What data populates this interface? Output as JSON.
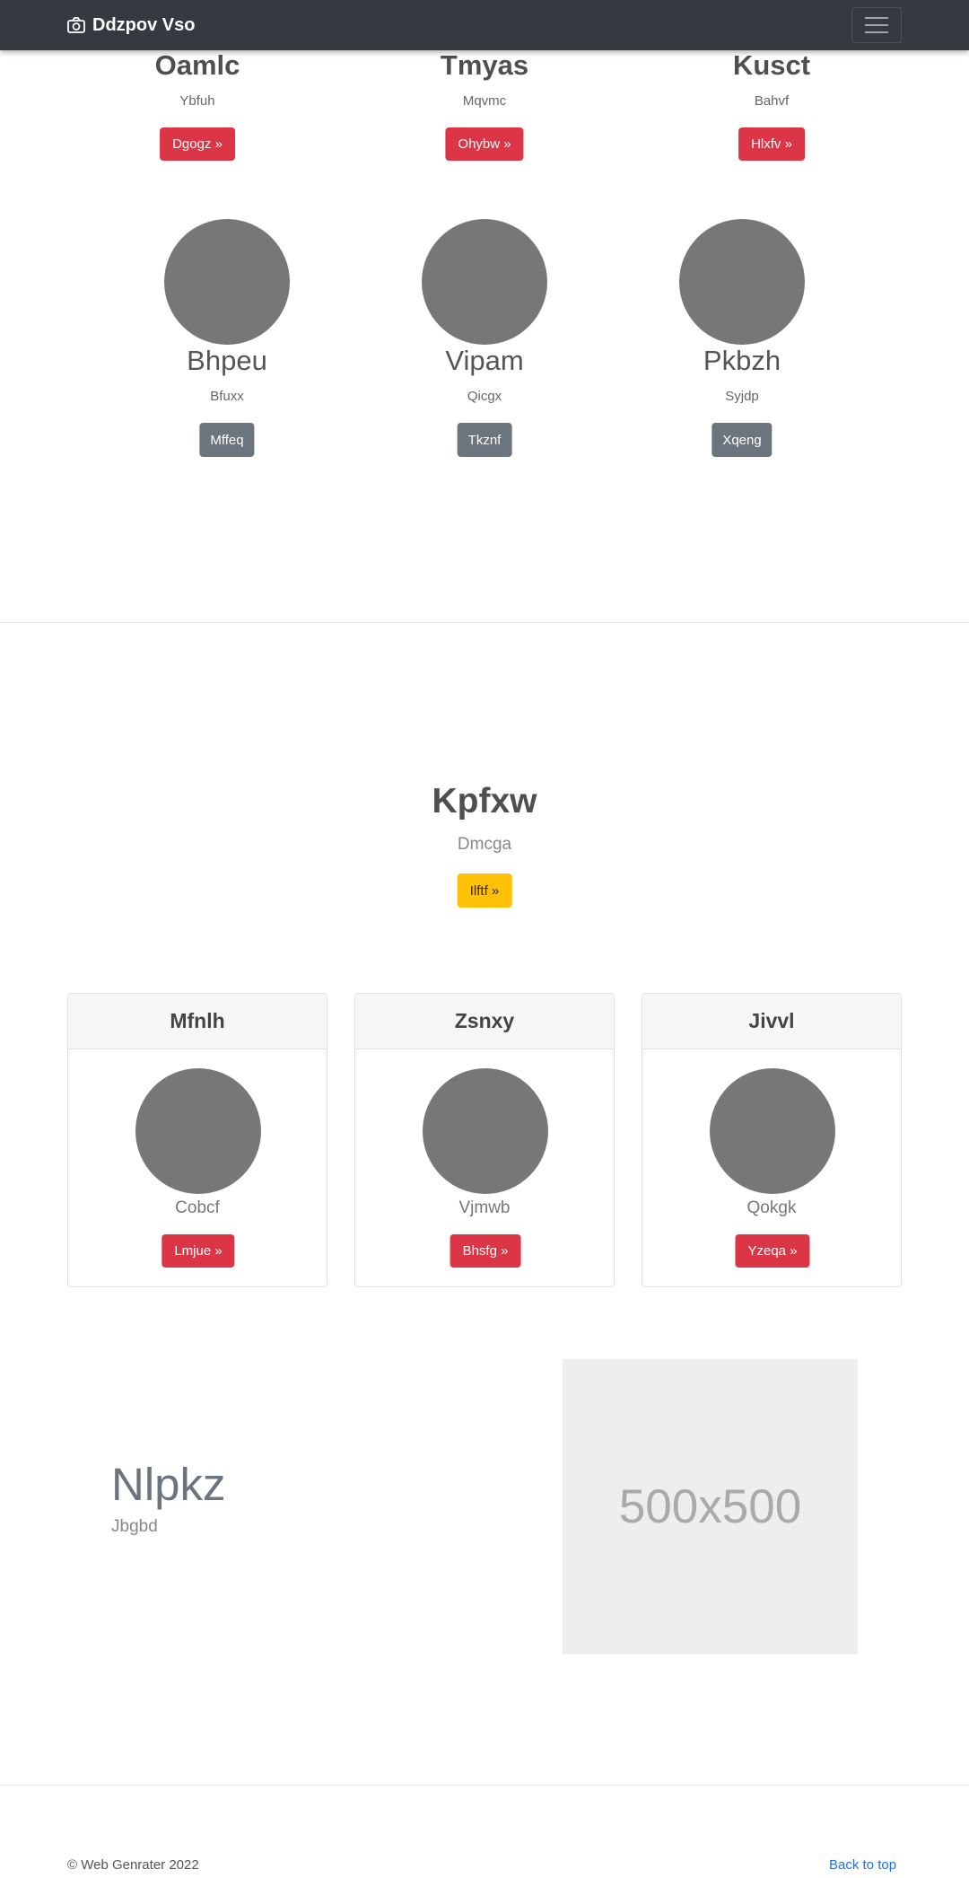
{
  "navbar": {
    "brand": "Ddzpov Vso",
    "camera_icon": "camera-icon",
    "menu_icon": "hamburger-menu-icon"
  },
  "top_row": [
    {
      "title": "Oamlc",
      "subtitle": "Ybfuh",
      "button": "Dgogz »"
    },
    {
      "title": "Tmyas",
      "subtitle": "Mqvmc",
      "button": "Ohybw »"
    },
    {
      "title": "Kusct",
      "subtitle": "Bahvf",
      "button": "Hlxfv »"
    }
  ],
  "circle_row": [
    {
      "title": "Bhpeu",
      "subtitle": "Bfuxx",
      "button": "Mffeq"
    },
    {
      "title": "Vipam",
      "subtitle": "Qicgx",
      "button": "Tkznf"
    },
    {
      "title": "Pkbzh",
      "subtitle": "Syjdp",
      "button": "Xqeng"
    }
  ],
  "hero": {
    "title": "Kpfxw",
    "subtitle": "Dmcga",
    "button": "Ilftf »"
  },
  "cards": [
    {
      "header": "Mfnlh",
      "text": "Cobcf",
      "button": "Lmjue »"
    },
    {
      "header": "Zsnxy",
      "text": "Vjmwb",
      "button": "Bhsfg »"
    },
    {
      "header": "Jivvl",
      "text": "Qokgk",
      "button": "Yzeqa »"
    }
  ],
  "feature": {
    "title": "Nlpkz",
    "subtitle": "Jbgbd",
    "image_label": "500x500"
  },
  "footer": {
    "copyright": "© Web Genrater 2022",
    "back_to_top": "Back to top"
  },
  "colors": {
    "navbar": "#343a40",
    "danger": "#dc3545",
    "secondary": "#6c757d",
    "warning": "#ffc107",
    "link": "#1a73e8"
  }
}
